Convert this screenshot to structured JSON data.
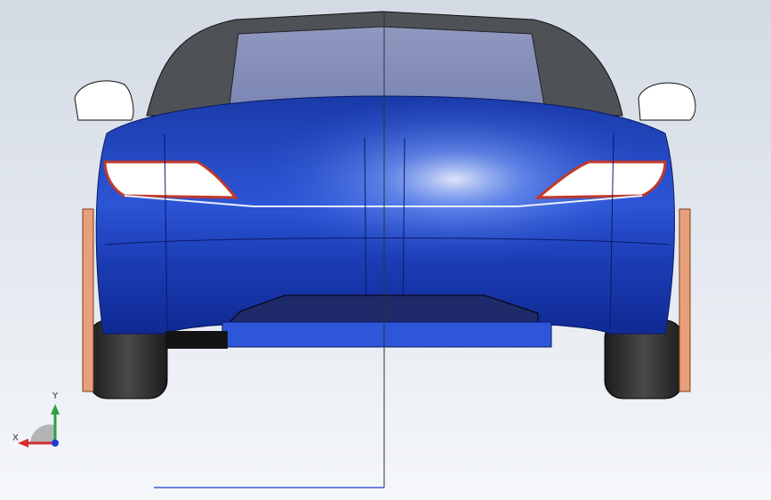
{
  "viewport": {
    "background_top": "#d3dae4",
    "background_bottom": "#f5f7fa",
    "model": {
      "body_color": "#1d3fb8",
      "glass_color": "#8690b8",
      "roof_color": "#4e5256",
      "tire_color": "#2a2a2a",
      "brake_color": "#e8a07c",
      "taillight_color": "#c0392b"
    }
  },
  "triad": {
    "y_label": "Y",
    "x_label": "X",
    "y_color": "#2ea043",
    "x_color": "#d32f2f",
    "z_color": "#1f3bd6"
  }
}
